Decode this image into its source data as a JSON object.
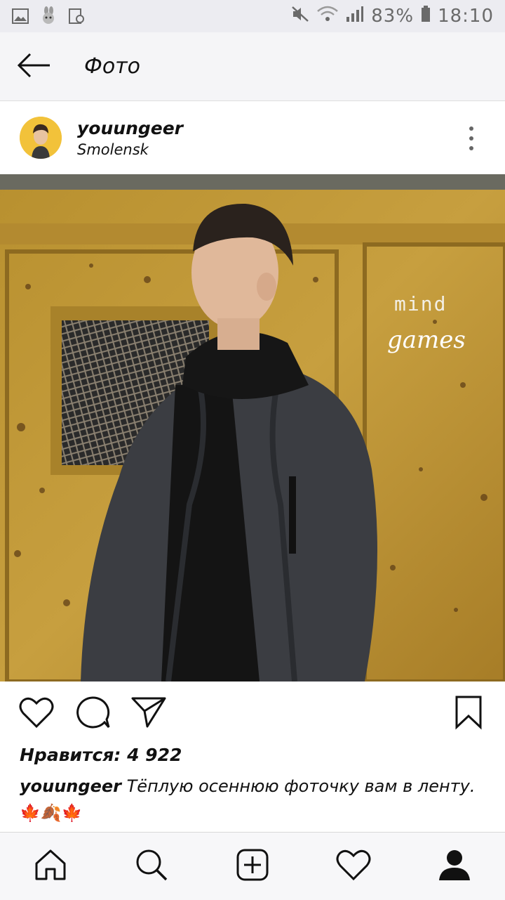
{
  "status": {
    "battery": "83%",
    "time": "18:10"
  },
  "appbar": {
    "title": "Фото"
  },
  "post": {
    "username": "youungeer",
    "location": "Smolensk",
    "overlay_line1": "mind",
    "overlay_line2": "games",
    "likes": "Нравится: 4 922",
    "caption_user": "youungeer",
    "caption_text": " Тёплую осеннюю фоточку вам в ленту.",
    "caption_emoji": "🍁🍂🍁"
  },
  "icons": {
    "back": "arrow-left-icon",
    "more": "more-vertical-icon",
    "like": "heart-icon",
    "comment": "comment-icon",
    "share": "send-icon",
    "save": "bookmark-icon",
    "home": "home-icon",
    "search": "search-icon",
    "add": "plus-square-icon",
    "activity": "heart-icon",
    "profile": "person-icon"
  }
}
